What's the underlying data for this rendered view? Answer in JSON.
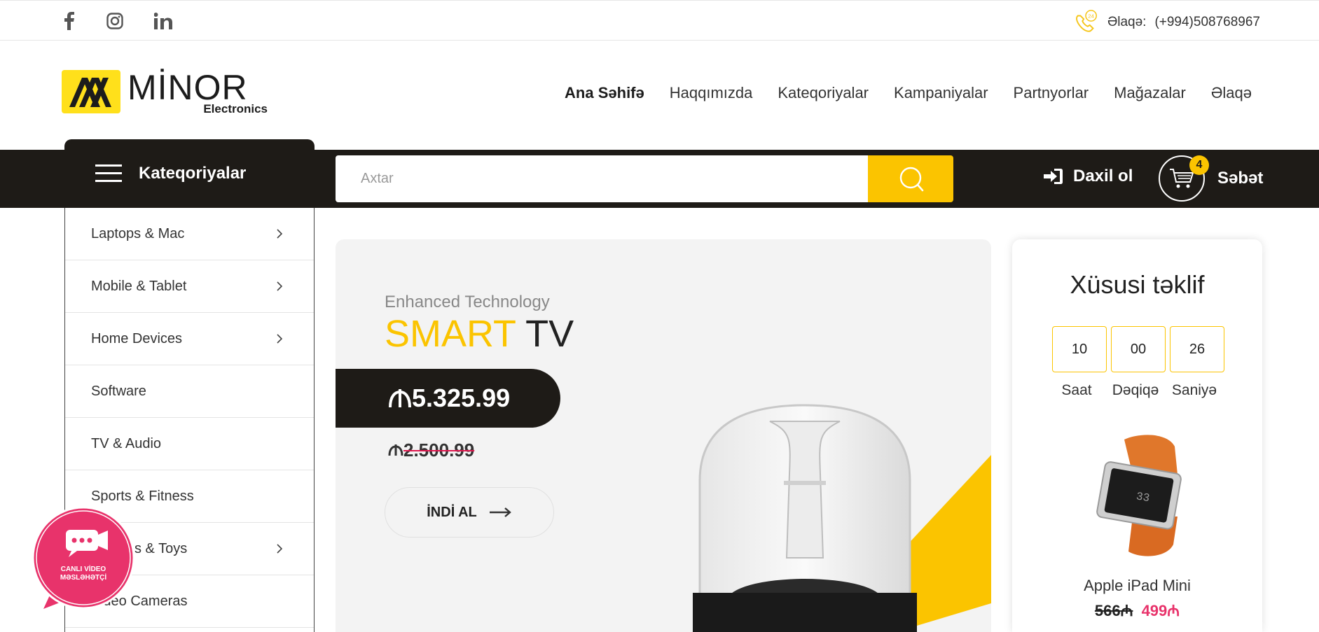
{
  "topbar": {
    "contact_label": "Əlaqə:",
    "contact_phone": "(+994)508768967",
    "phone_badge": "24",
    "social": [
      "facebook-icon",
      "instagram-icon",
      "linkedin-icon"
    ]
  },
  "logo": {
    "name": "MİNOR",
    "sub": "Electronics"
  },
  "nav": {
    "items": [
      "Ana Səhifə",
      "Haqqımızda",
      "Kateqoriyalar",
      "Kampaniyalar",
      "Partnyorlar",
      "Mağazalar",
      "Əlaqə"
    ]
  },
  "toolbar": {
    "categories_label": "Kateqoriyalar",
    "search_placeholder": "Axtar",
    "login_label": "Daxil ol",
    "cart_label": "Səbət",
    "cart_count": "4"
  },
  "sidebar": {
    "items": [
      {
        "label": "Laptops & Mac",
        "has_chevron": true
      },
      {
        "label": "Mobile & Tablet",
        "has_chevron": true
      },
      {
        "label": "Home Devices",
        "has_chevron": true
      },
      {
        "label": "Software",
        "has_chevron": false
      },
      {
        "label": "TV & Audio",
        "has_chevron": false
      },
      {
        "label": "Sports & Fitness",
        "has_chevron": false
      },
      {
        "label": "s & Toys",
        "has_chevron": true
      },
      {
        "label": "Video Cameras",
        "has_chevron": false
      }
    ]
  },
  "hero": {
    "subtitle": "Enhanced Technology",
    "title_highlight": "SMART",
    "title_rest": "TV",
    "price": "5.325.99",
    "old_price": "2.500.99",
    "buy_label": "İNDİ AL"
  },
  "offer": {
    "title": "Xüsusi təklif",
    "timer": [
      {
        "value": "10",
        "label": "Saat"
      },
      {
        "value": "00",
        "label": "Dəqiqə"
      },
      {
        "value": "26",
        "label": "Saniyə"
      }
    ],
    "product_name": "Apple iPad Mini",
    "old_price": "566",
    "new_price": "499"
  },
  "chat": {
    "line1": "CANLI VİDEO",
    "line2": "MƏSLƏHƏTÇİ"
  },
  "colors": {
    "accent": "#fbc400",
    "dark": "#1e1b17",
    "pink": "#e8336b"
  }
}
